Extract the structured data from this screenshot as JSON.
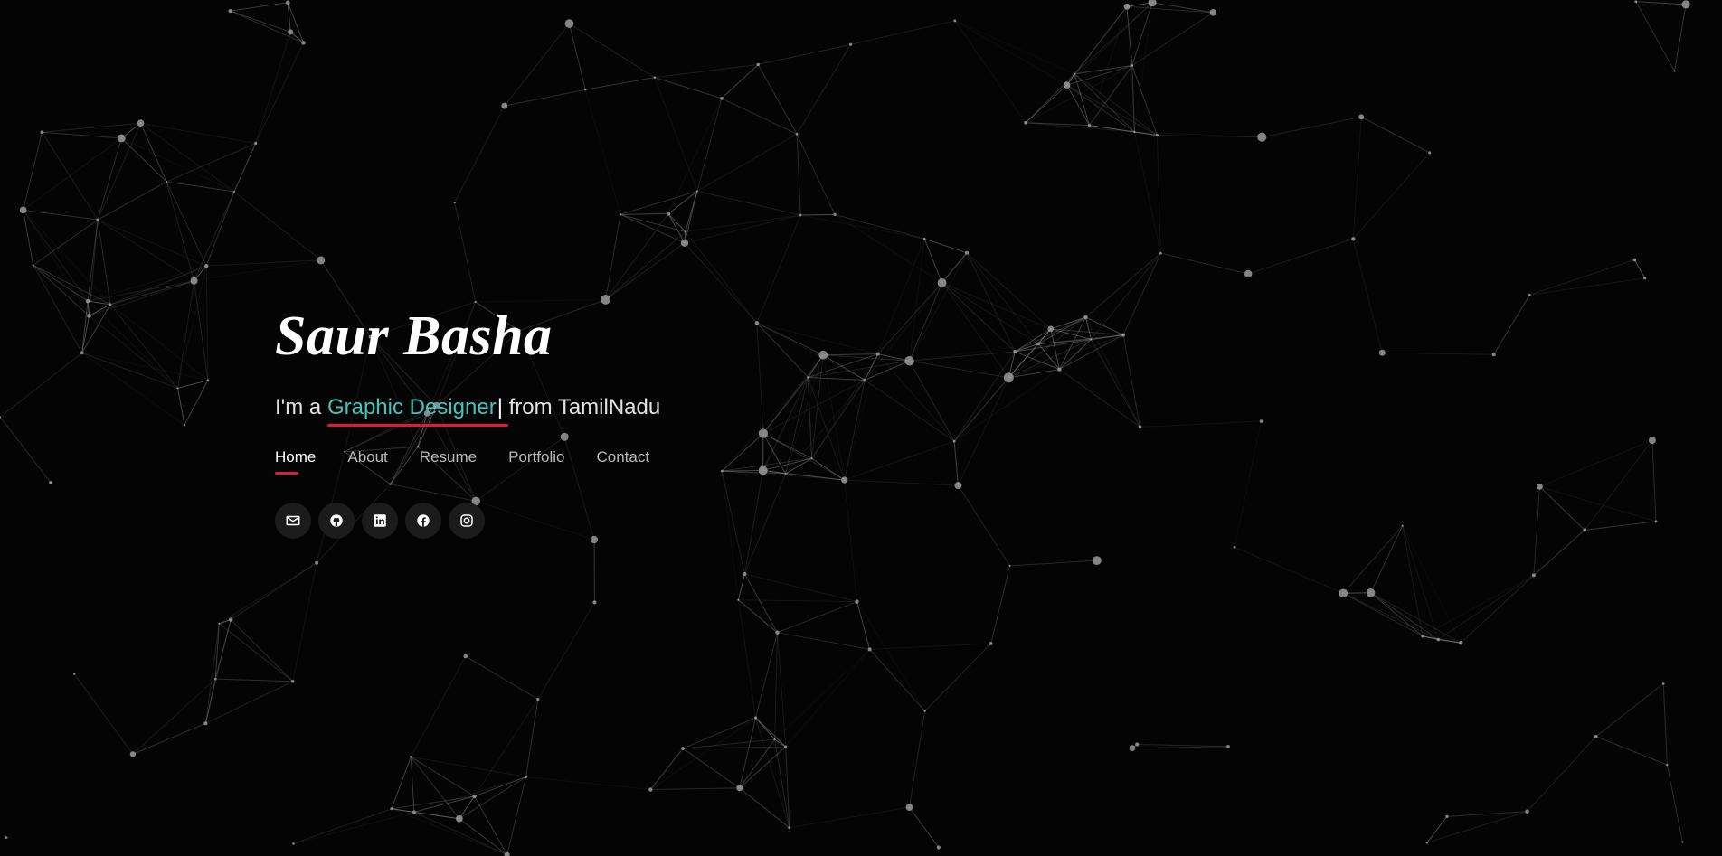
{
  "hero": {
    "name": "Saur Basha",
    "tagline_prefix": "I'm a ",
    "typed_role": "Graphic Designer",
    "caret": "|",
    "tagline_suffix": " from TamilNadu"
  },
  "nav": {
    "items": [
      {
        "label": "Home",
        "active": true
      },
      {
        "label": "About",
        "active": false
      },
      {
        "label": "Resume",
        "active": false
      },
      {
        "label": "Portfolio",
        "active": false
      },
      {
        "label": "Contact",
        "active": false
      }
    ]
  },
  "social": {
    "icons": [
      "envelope-icon",
      "github-icon",
      "linkedin-icon",
      "facebook-icon",
      "instagram-icon"
    ]
  },
  "colors": {
    "background": "#040404",
    "accent_teal": "#3fc6c0",
    "accent_red": "#e0193f",
    "particle": "#9a9a9a"
  }
}
